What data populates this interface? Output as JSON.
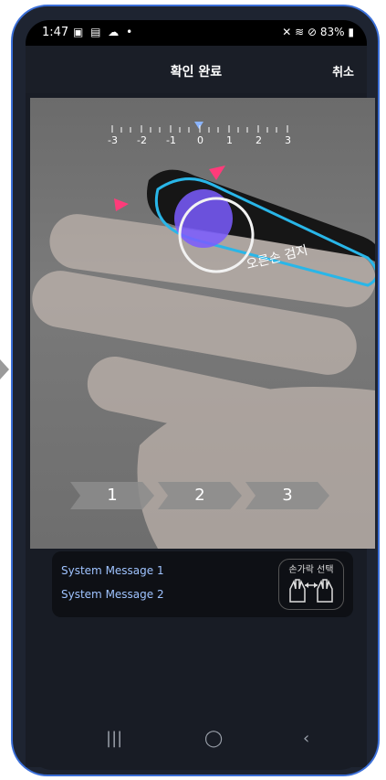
{
  "status": {
    "time": "1:47",
    "left_icons": "▣ ▤ ☁ •",
    "right_icons": "✕ ≋ ⊘",
    "battery": "83%"
  },
  "header": {
    "title": "확인 완료",
    "cancel_label": "취소"
  },
  "camera": {
    "ruler_ticks": [
      "-3",
      "-2",
      "-1",
      "0",
      "1",
      "2",
      "3"
    ],
    "finger_label": "오른손 검지",
    "steps": [
      "1",
      "2",
      "3"
    ]
  },
  "messages": {
    "line1": "System Message 1",
    "line2": "System Message 2",
    "finger_select_label": "손가락 선택"
  },
  "colors": {
    "accent": "#3b6fd8",
    "outline": "#29b6e8",
    "marker": "#ff3b7a",
    "target": "#7a5cff"
  }
}
